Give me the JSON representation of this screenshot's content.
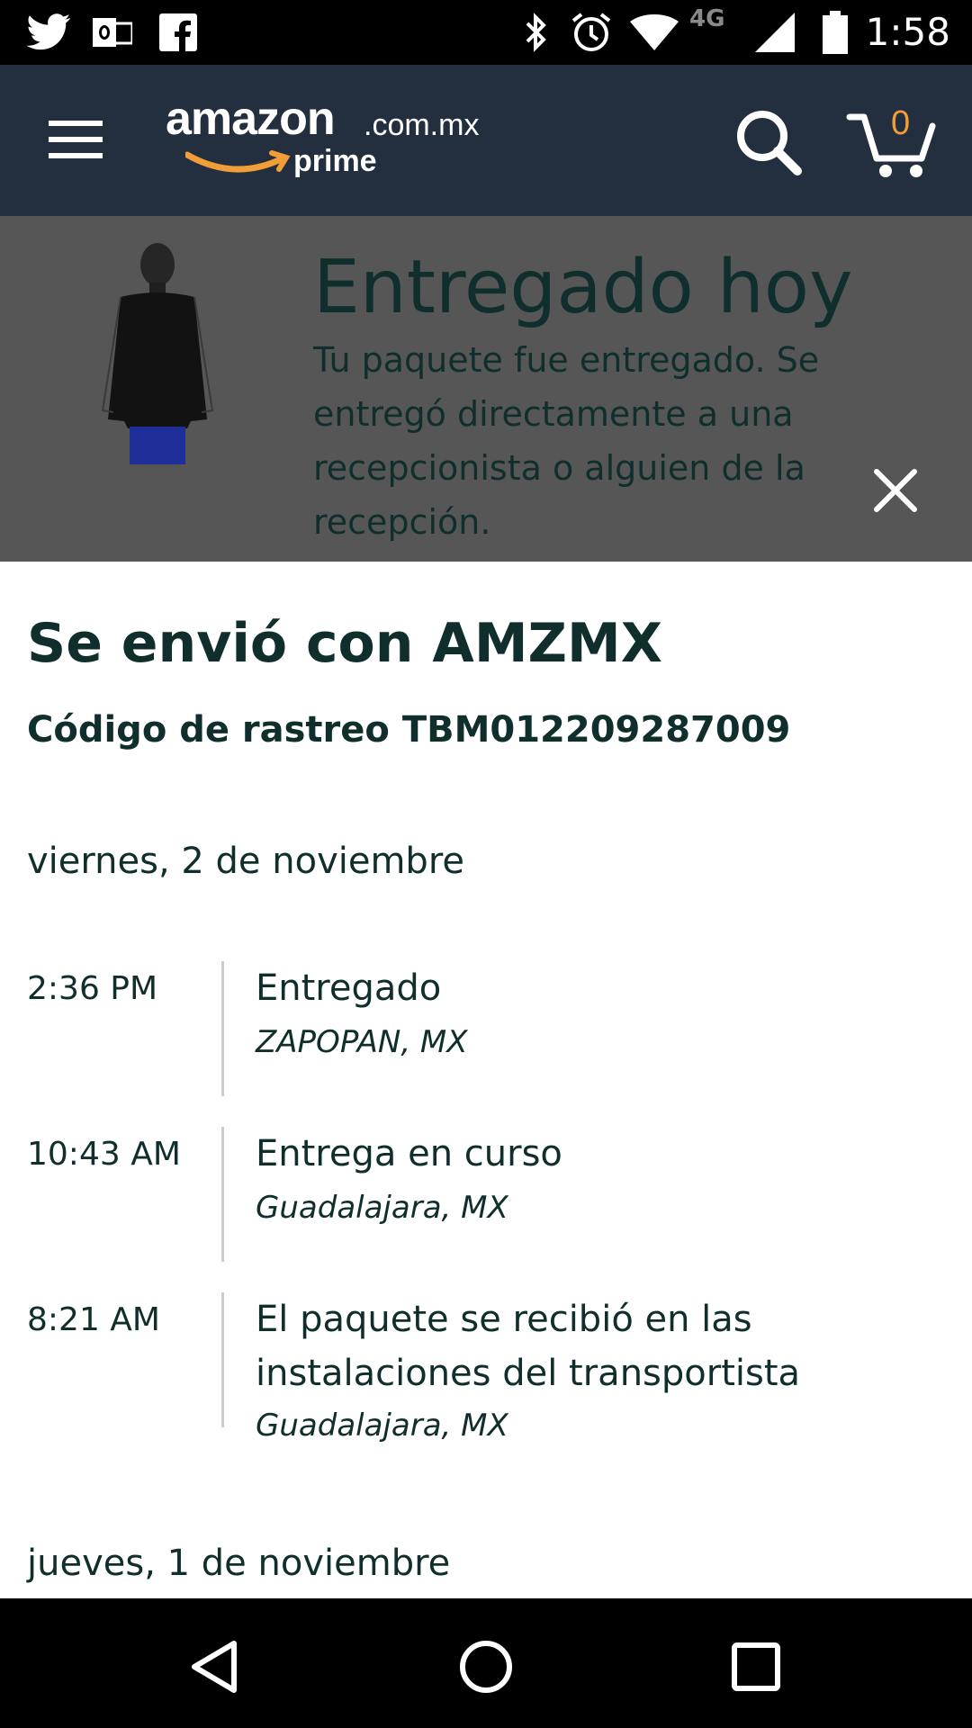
{
  "status_bar": {
    "time": "1:58",
    "network": "4G",
    "icons": [
      "twitter-icon",
      "outlook-icon",
      "facebook-icon",
      "bluetooth-icon",
      "alarm-icon",
      "wifi-icon",
      "signal-icon",
      "battery-icon"
    ]
  },
  "header": {
    "logo_word": "amazon",
    "logo_domain": ".com.mx",
    "logo_sub": "prime",
    "cart_count": "0",
    "colors": {
      "background": "#232f3e",
      "accent": "#f19e38"
    }
  },
  "banner": {
    "title": "Entregado hoy",
    "message": "Tu paquete fue entregado. Se entregó directamente a una recepcionista o alguien de la recepción."
  },
  "tracking": {
    "carrier_title": "Se envió con AMZMX",
    "tracking_code": "Código de rastreo TBM012209287009",
    "days": [
      {
        "date": "viernes, 2 de noviembre",
        "events": [
          {
            "time": "2:36 PM",
            "status": "Entregado",
            "location": "ZAPOPAN, MX"
          },
          {
            "time": "10:43 AM",
            "status": "Entrega en curso",
            "location": "Guadalajara, MX"
          },
          {
            "time": "8:21 AM",
            "status": "El paquete se recibió en las instalaciones del transportista",
            "location": "Guadalajara, MX"
          }
        ]
      },
      {
        "date": "jueves, 1 de noviembre",
        "events": []
      }
    ]
  },
  "nav_bar": {
    "buttons": [
      "back-icon",
      "home-icon",
      "recents-icon"
    ]
  }
}
